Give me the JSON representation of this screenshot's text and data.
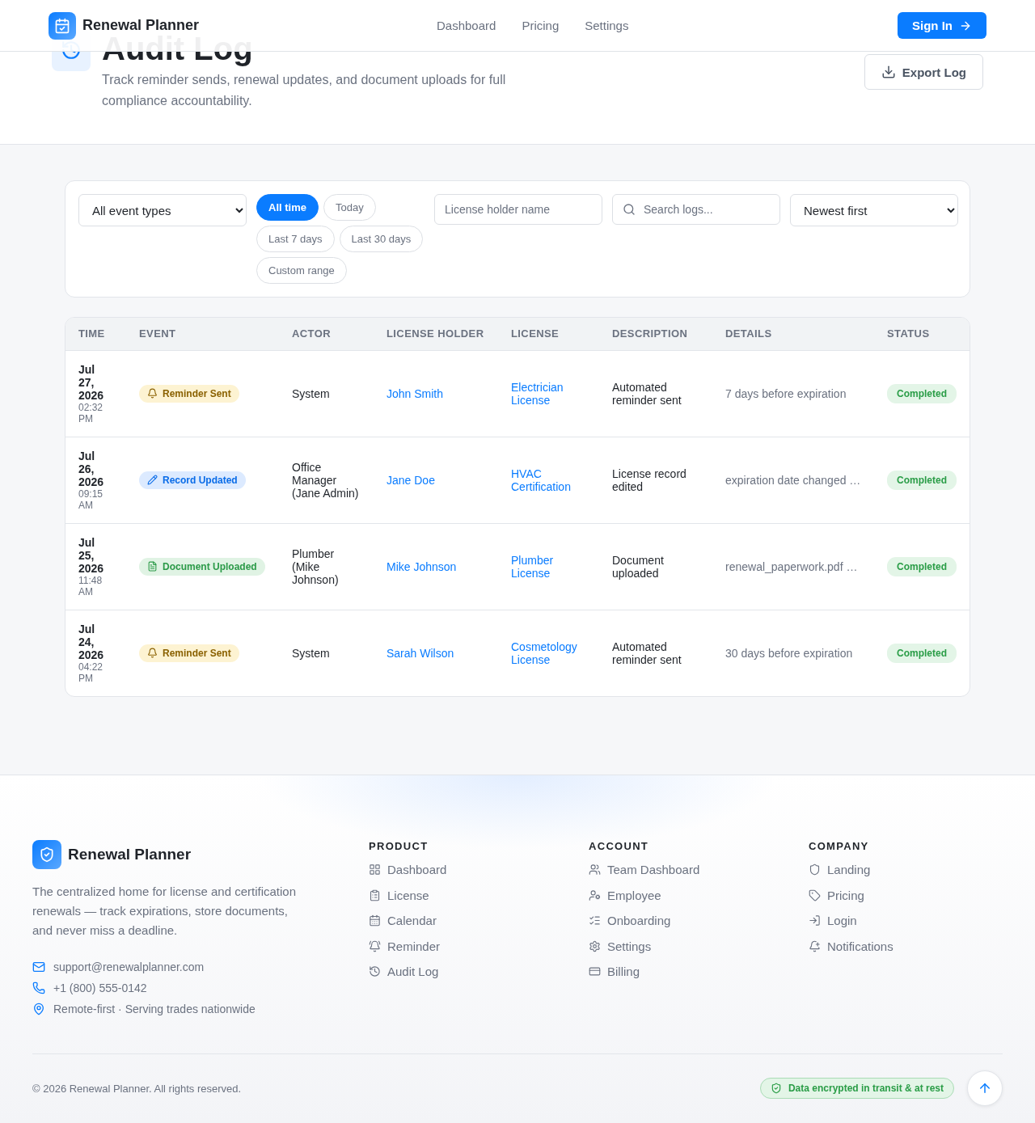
{
  "header": {
    "brand": "Renewal Planner",
    "nav": [
      {
        "label": "Dashboard"
      },
      {
        "label": "Pricing"
      },
      {
        "label": "Settings"
      }
    ],
    "sign_in": "Sign In"
  },
  "hero": {
    "title": "Audit Log",
    "subtitle": "Track reminder sends, renewal updates, and document uploads for full compliance accountability.",
    "export": "Export Log"
  },
  "filters": {
    "event_type": "All event types",
    "ranges": [
      {
        "label": "All time",
        "selected": true
      },
      {
        "label": "Today",
        "selected": false
      },
      {
        "label": "Last 7 days",
        "selected": false
      },
      {
        "label": "Last 30 days",
        "selected": false
      },
      {
        "label": "Custom range",
        "selected": false
      }
    ],
    "holder": {
      "placeholder": "License holder name"
    },
    "search": {
      "placeholder": "Search logs..."
    },
    "sort": "Newest first"
  },
  "table": {
    "columns": [
      "TIME",
      "EVENT",
      "ACTOR",
      "LICENSE HOLDER",
      "LICENSE",
      "DESCRIPTION",
      "DETAILS",
      "STATUS"
    ],
    "rows": [
      {
        "date": "Jul 27, 2026",
        "time": "02:32 PM",
        "event": {
          "kind": "reminder",
          "label": "Reminder Sent"
        },
        "actor": "System",
        "holder": "John Smith",
        "license": "Electrician License",
        "description": "Automated reminder sent",
        "details": "7 days before expiration",
        "status": {
          "kind": "completed",
          "label": "Completed"
        }
      },
      {
        "date": "Jul 26, 2026",
        "time": "09:15 AM",
        "event": {
          "kind": "update",
          "label": "Record Updated"
        },
        "actor": "Office Manager (Jane Admin)",
        "holder": "Jane Doe",
        "license": "HVAC Certification",
        "description": "License record edited",
        "details": "expiration date changed …",
        "status": {
          "kind": "completed",
          "label": "Completed"
        }
      },
      {
        "date": "Jul 25, 2026",
        "time": "11:48 AM",
        "event": {
          "kind": "upload",
          "label": "Document Uploaded"
        },
        "actor": "Plumber (Mike Johnson)",
        "holder": "Mike Johnson",
        "license": "Plumber License",
        "description": "Document uploaded",
        "details": "renewal_paperwork.pdf …",
        "status": {
          "kind": "completed",
          "label": "Completed"
        }
      },
      {
        "date": "Jul 24, 2026",
        "time": "04:22 PM",
        "event": {
          "kind": "reminder",
          "label": "Reminder Sent"
        },
        "actor": "System",
        "holder": "Sarah Wilson",
        "license": "Cosmetology License",
        "description": "Automated reminder sent",
        "details": "30 days before expiration",
        "status": {
          "kind": "completed",
          "label": "Completed"
        }
      }
    ]
  },
  "footer": {
    "brand": "Renewal Planner",
    "about": "The centralized home for license and certification renewals — track expirations, store documents, and never miss a deadline.",
    "contacts": [
      {
        "kind": "email",
        "text": "support@renewalplanner.com"
      },
      {
        "kind": "phone",
        "text": "+1 (800) 555-0142"
      },
      {
        "kind": "location",
        "text": "Remote-first · Serving trades nationwide"
      }
    ],
    "columns": [
      {
        "title": "PRODUCT",
        "links": [
          {
            "kind": "grid",
            "label": "Dashboard"
          },
          {
            "kind": "clipboard",
            "label": "License"
          },
          {
            "kind": "calendar",
            "label": "Calendar"
          },
          {
            "kind": "bell-ring",
            "label": "Reminder"
          },
          {
            "kind": "history",
            "label": "Audit Log"
          }
        ]
      },
      {
        "title": "ACCOUNT",
        "links": [
          {
            "kind": "users",
            "label": "Team Dashboard"
          },
          {
            "kind": "user-cog",
            "label": "Employee"
          },
          {
            "kind": "list-checks",
            "label": "Onboarding"
          },
          {
            "kind": "gear",
            "label": "Settings"
          },
          {
            "kind": "card",
            "label": "Billing"
          }
        ]
      },
      {
        "title": "COMPANY",
        "links": [
          {
            "kind": "shield",
            "label": "Landing"
          },
          {
            "kind": "tag",
            "label": "Pricing"
          },
          {
            "kind": "login",
            "label": "Login"
          },
          {
            "kind": "bell-plus",
            "label": "Notifications"
          }
        ]
      }
    ],
    "copyright": "© 2026 Renewal Planner. All rights reserved.",
    "security_badge": "Data encrypted in transit & at rest"
  }
}
